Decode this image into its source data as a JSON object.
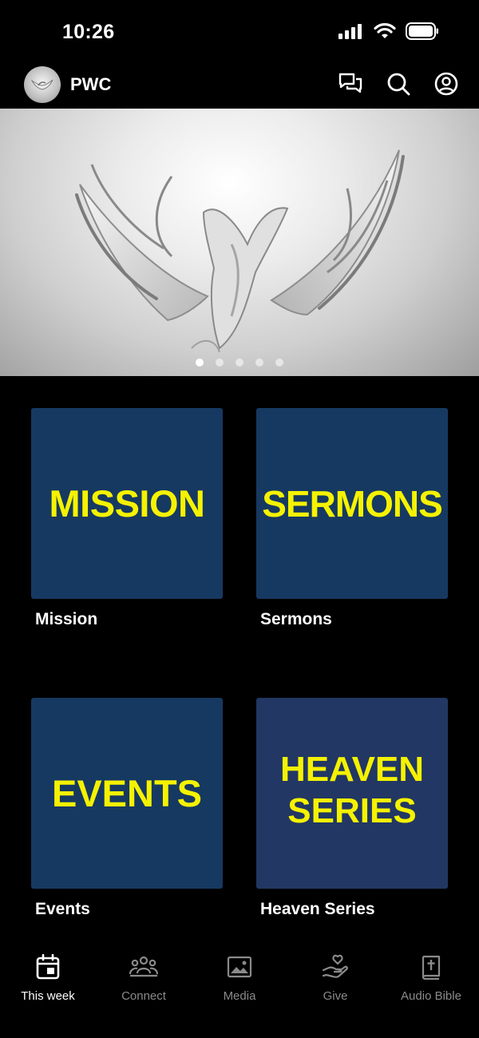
{
  "status_bar": {
    "time": "10:26"
  },
  "header": {
    "title": "PWC"
  },
  "carousel": {
    "slide_count": 5,
    "active_index": 0
  },
  "tiles": [
    {
      "card_text": "MISSION",
      "label": "Mission"
    },
    {
      "card_text": "SERMONS",
      "label": "Sermons"
    },
    {
      "card_text": "EVENTS",
      "label": "Events"
    },
    {
      "card_text": "HEAVEN SERIES",
      "label": "Heaven Series"
    }
  ],
  "tab_bar": {
    "active": "This week",
    "tabs": [
      {
        "label": "This week",
        "icon": "calendar-icon"
      },
      {
        "label": "Connect",
        "icon": "people-group-icon"
      },
      {
        "label": "Media",
        "icon": "image-icon"
      },
      {
        "label": "Give",
        "icon": "hand-heart-icon"
      },
      {
        "label": "Audio Bible",
        "icon": "bible-icon"
      }
    ]
  },
  "colors": {
    "background": "#000000",
    "tile_blue": "#163961",
    "tile_heaven": "#223763",
    "tile_text": "#f5f200",
    "inactive_tab": "#8a8a8a"
  }
}
